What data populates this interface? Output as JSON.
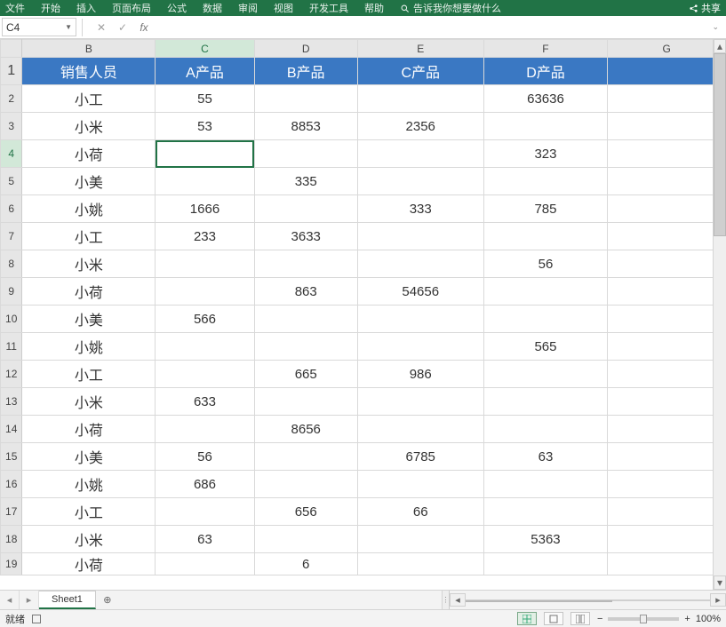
{
  "ribbon": {
    "tabs": [
      "文件",
      "开始",
      "插入",
      "页面布局",
      "公式",
      "数据",
      "审阅",
      "视图",
      "开发工具",
      "帮助"
    ],
    "tell_me_label": "告诉我你想要做什么",
    "share_label": "共享"
  },
  "namebox": {
    "value": "C4"
  },
  "formula": {
    "value": ""
  },
  "columns": [
    "B",
    "C",
    "D",
    "E",
    "F",
    "G"
  ],
  "header_row": {
    "B": "销售人员",
    "C": "A产品",
    "D": "B产品",
    "E": "C产品",
    "F": "D产品",
    "G": ""
  },
  "rows": [
    {
      "n": "2",
      "B": "小工",
      "C": "55",
      "D": "",
      "E": "",
      "F": "63636"
    },
    {
      "n": "3",
      "B": "小米",
      "C": "53",
      "D": "8853",
      "E": "2356",
      "F": ""
    },
    {
      "n": "4",
      "B": "小荷",
      "C": "",
      "D": "",
      "E": "",
      "F": "323"
    },
    {
      "n": "5",
      "B": "小美",
      "C": "",
      "D": "335",
      "E": "",
      "F": ""
    },
    {
      "n": "6",
      "B": "小姚",
      "C": "1666",
      "D": "",
      "E": "333",
      "F": "785"
    },
    {
      "n": "7",
      "B": "小工",
      "C": "233",
      "D": "3633",
      "E": "",
      "F": ""
    },
    {
      "n": "8",
      "B": "小米",
      "C": "",
      "D": "",
      "E": "",
      "F": "56"
    },
    {
      "n": "9",
      "B": "小荷",
      "C": "",
      "D": "863",
      "E": "54656",
      "F": ""
    },
    {
      "n": "10",
      "B": "小美",
      "C": "566",
      "D": "",
      "E": "",
      "F": ""
    },
    {
      "n": "11",
      "B": "小姚",
      "C": "",
      "D": "",
      "E": "",
      "F": "565"
    },
    {
      "n": "12",
      "B": "小工",
      "C": "",
      "D": "665",
      "E": "986",
      "F": ""
    },
    {
      "n": "13",
      "B": "小米",
      "C": "633",
      "D": "",
      "E": "",
      "F": ""
    },
    {
      "n": "14",
      "B": "小荷",
      "C": "",
      "D": "8656",
      "E": "",
      "F": ""
    },
    {
      "n": "15",
      "B": "小美",
      "C": "56",
      "D": "",
      "E": "6785",
      "F": "63"
    },
    {
      "n": "16",
      "B": "小姚",
      "C": "686",
      "D": "",
      "E": "",
      "F": ""
    },
    {
      "n": "17",
      "B": "小工",
      "C": "",
      "D": "656",
      "E": "66",
      "F": ""
    },
    {
      "n": "18",
      "B": "小米",
      "C": "63",
      "D": "",
      "E": "",
      "F": "5363"
    },
    {
      "n": "19",
      "B": "小荷",
      "C": "",
      "D": "6",
      "E": "",
      "F": ""
    }
  ],
  "sheet": {
    "tabs": [
      "Sheet1"
    ]
  },
  "status": {
    "mode": "就绪",
    "zoom": "100%"
  }
}
